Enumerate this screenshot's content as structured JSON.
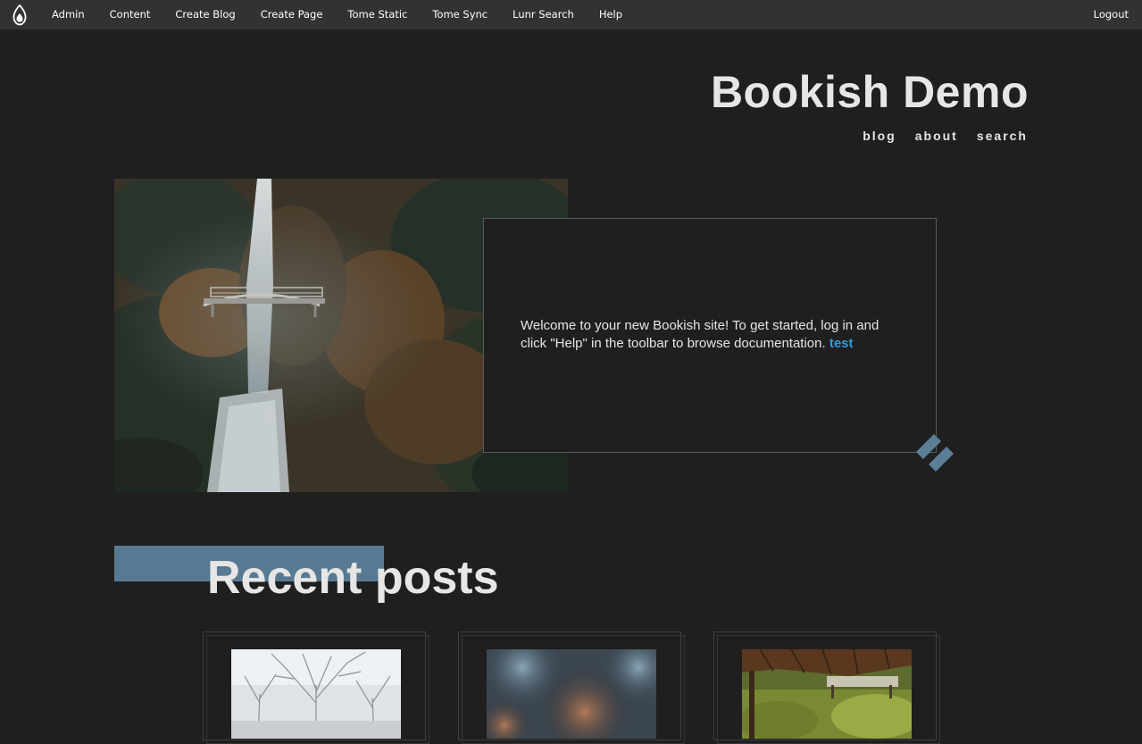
{
  "toolbar": {
    "logo_icon": "drupal-drop-icon",
    "items": [
      "Admin",
      "Content",
      "Create Blog",
      "Create Page",
      "Tome Static",
      "Tome Sync",
      "Lunr Search",
      "Help"
    ],
    "logout": "Logout"
  },
  "site": {
    "title": "Bookish Demo",
    "nav": [
      "blog",
      "about",
      "search"
    ]
  },
  "hero": {
    "image_description": "waterfall-bridge-photo",
    "text": "Welcome to your new Bookish site! To get started, log in and click \"Help\" in the toolbar to browse documentation.",
    "link": "test",
    "link_color": "#2a9be0"
  },
  "recent": {
    "title": "Recent posts",
    "accent_color": "#577a92",
    "cards": [
      {
        "thumb": "snowy-tree-photo"
      },
      {
        "thumb": "blurred-bokeh-photo"
      },
      {
        "thumb": "wooden-pavilion-garden-photo"
      }
    ]
  },
  "colors": {
    "background": "#1f1f1f",
    "toolbar": "#323232",
    "text": "#e6e6e6",
    "accent": "#577a92"
  }
}
